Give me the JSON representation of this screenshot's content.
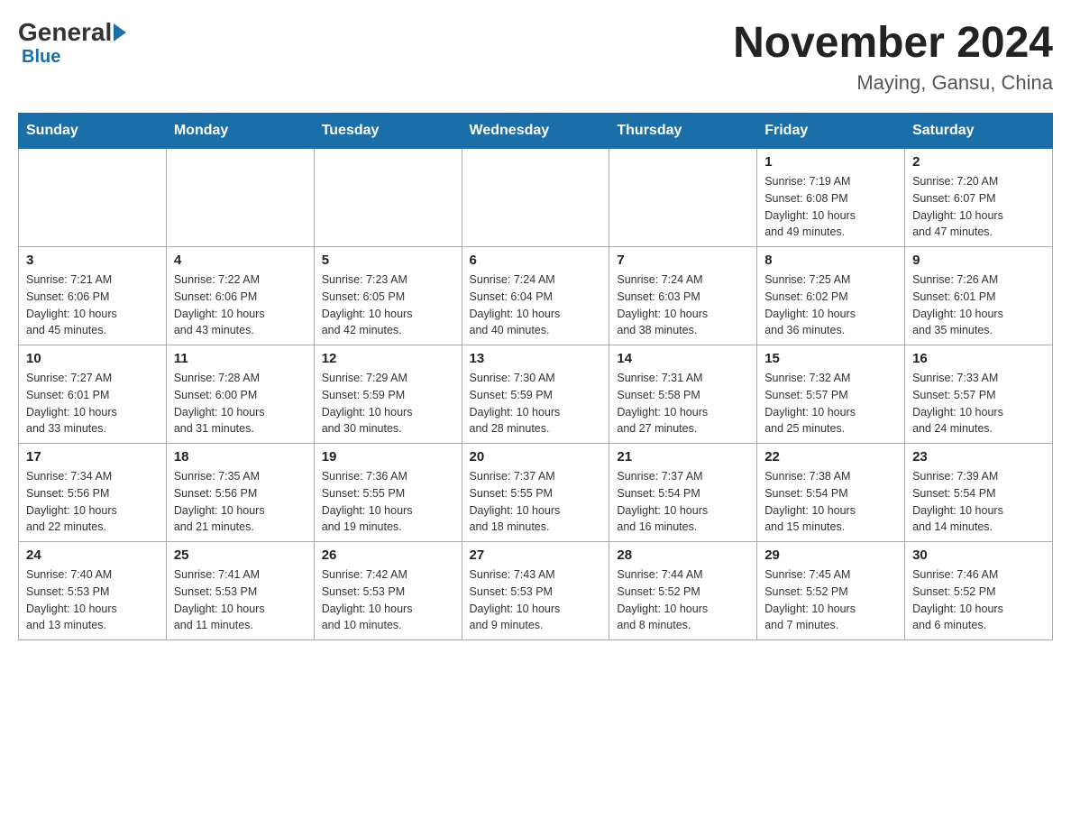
{
  "header": {
    "logo_general": "General",
    "logo_blue": "Blue",
    "main_title": "November 2024",
    "subtitle": "Maying, Gansu, China"
  },
  "days_of_week": [
    "Sunday",
    "Monday",
    "Tuesday",
    "Wednesday",
    "Thursday",
    "Friday",
    "Saturday"
  ],
  "weeks": [
    [
      {
        "day": "",
        "info": ""
      },
      {
        "day": "",
        "info": ""
      },
      {
        "day": "",
        "info": ""
      },
      {
        "day": "",
        "info": ""
      },
      {
        "day": "",
        "info": ""
      },
      {
        "day": "1",
        "info": "Sunrise: 7:19 AM\nSunset: 6:08 PM\nDaylight: 10 hours\nand 49 minutes."
      },
      {
        "day": "2",
        "info": "Sunrise: 7:20 AM\nSunset: 6:07 PM\nDaylight: 10 hours\nand 47 minutes."
      }
    ],
    [
      {
        "day": "3",
        "info": "Sunrise: 7:21 AM\nSunset: 6:06 PM\nDaylight: 10 hours\nand 45 minutes."
      },
      {
        "day": "4",
        "info": "Sunrise: 7:22 AM\nSunset: 6:06 PM\nDaylight: 10 hours\nand 43 minutes."
      },
      {
        "day": "5",
        "info": "Sunrise: 7:23 AM\nSunset: 6:05 PM\nDaylight: 10 hours\nand 42 minutes."
      },
      {
        "day": "6",
        "info": "Sunrise: 7:24 AM\nSunset: 6:04 PM\nDaylight: 10 hours\nand 40 minutes."
      },
      {
        "day": "7",
        "info": "Sunrise: 7:24 AM\nSunset: 6:03 PM\nDaylight: 10 hours\nand 38 minutes."
      },
      {
        "day": "8",
        "info": "Sunrise: 7:25 AM\nSunset: 6:02 PM\nDaylight: 10 hours\nand 36 minutes."
      },
      {
        "day": "9",
        "info": "Sunrise: 7:26 AM\nSunset: 6:01 PM\nDaylight: 10 hours\nand 35 minutes."
      }
    ],
    [
      {
        "day": "10",
        "info": "Sunrise: 7:27 AM\nSunset: 6:01 PM\nDaylight: 10 hours\nand 33 minutes."
      },
      {
        "day": "11",
        "info": "Sunrise: 7:28 AM\nSunset: 6:00 PM\nDaylight: 10 hours\nand 31 minutes."
      },
      {
        "day": "12",
        "info": "Sunrise: 7:29 AM\nSunset: 5:59 PM\nDaylight: 10 hours\nand 30 minutes."
      },
      {
        "day": "13",
        "info": "Sunrise: 7:30 AM\nSunset: 5:59 PM\nDaylight: 10 hours\nand 28 minutes."
      },
      {
        "day": "14",
        "info": "Sunrise: 7:31 AM\nSunset: 5:58 PM\nDaylight: 10 hours\nand 27 minutes."
      },
      {
        "day": "15",
        "info": "Sunrise: 7:32 AM\nSunset: 5:57 PM\nDaylight: 10 hours\nand 25 minutes."
      },
      {
        "day": "16",
        "info": "Sunrise: 7:33 AM\nSunset: 5:57 PM\nDaylight: 10 hours\nand 24 minutes."
      }
    ],
    [
      {
        "day": "17",
        "info": "Sunrise: 7:34 AM\nSunset: 5:56 PM\nDaylight: 10 hours\nand 22 minutes."
      },
      {
        "day": "18",
        "info": "Sunrise: 7:35 AM\nSunset: 5:56 PM\nDaylight: 10 hours\nand 21 minutes."
      },
      {
        "day": "19",
        "info": "Sunrise: 7:36 AM\nSunset: 5:55 PM\nDaylight: 10 hours\nand 19 minutes."
      },
      {
        "day": "20",
        "info": "Sunrise: 7:37 AM\nSunset: 5:55 PM\nDaylight: 10 hours\nand 18 minutes."
      },
      {
        "day": "21",
        "info": "Sunrise: 7:37 AM\nSunset: 5:54 PM\nDaylight: 10 hours\nand 16 minutes."
      },
      {
        "day": "22",
        "info": "Sunrise: 7:38 AM\nSunset: 5:54 PM\nDaylight: 10 hours\nand 15 minutes."
      },
      {
        "day": "23",
        "info": "Sunrise: 7:39 AM\nSunset: 5:54 PM\nDaylight: 10 hours\nand 14 minutes."
      }
    ],
    [
      {
        "day": "24",
        "info": "Sunrise: 7:40 AM\nSunset: 5:53 PM\nDaylight: 10 hours\nand 13 minutes."
      },
      {
        "day": "25",
        "info": "Sunrise: 7:41 AM\nSunset: 5:53 PM\nDaylight: 10 hours\nand 11 minutes."
      },
      {
        "day": "26",
        "info": "Sunrise: 7:42 AM\nSunset: 5:53 PM\nDaylight: 10 hours\nand 10 minutes."
      },
      {
        "day": "27",
        "info": "Sunrise: 7:43 AM\nSunset: 5:53 PM\nDaylight: 10 hours\nand 9 minutes."
      },
      {
        "day": "28",
        "info": "Sunrise: 7:44 AM\nSunset: 5:52 PM\nDaylight: 10 hours\nand 8 minutes."
      },
      {
        "day": "29",
        "info": "Sunrise: 7:45 AM\nSunset: 5:52 PM\nDaylight: 10 hours\nand 7 minutes."
      },
      {
        "day": "30",
        "info": "Sunrise: 7:46 AM\nSunset: 5:52 PM\nDaylight: 10 hours\nand 6 minutes."
      }
    ]
  ]
}
